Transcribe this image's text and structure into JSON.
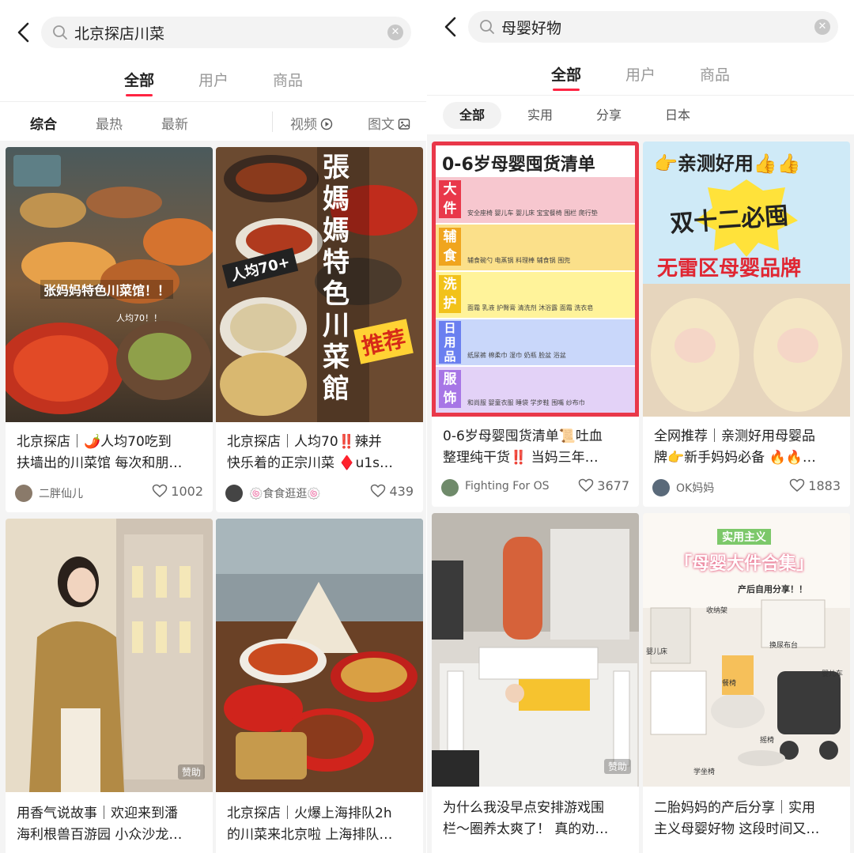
{
  "left": {
    "search_query": "北京探店川菜",
    "tabs": [
      {
        "label": "全部",
        "active": true
      },
      {
        "label": "用户",
        "active": false
      },
      {
        "label": "商品",
        "active": false
      }
    ],
    "filters": {
      "sort": [
        "综合",
        "最热",
        "最新"
      ],
      "video": "视频",
      "image_text": "图文"
    },
    "cards": [
      {
        "image_texts": [
          "张妈妈特色川菜馆！！",
          "人均70！！"
        ],
        "title_line1": "北京探店｜🌶️人均70吃到",
        "title_line2": "扶墙出的川菜馆 每次和朋…",
        "author": "二胖仙儿",
        "likes": "1002"
      },
      {
        "image_texts": [
          "張媽媽特色川菜館",
          "人均70+",
          "推荐"
        ],
        "title_line1": "北京探店｜人均70‼️辣并",
        "title_line2": "快乐着的正宗川菜 ♦️u1s…",
        "author": "🍥食食逛逛🍥",
        "likes": "439"
      },
      {
        "image_texts": [],
        "sponsor": "赞助",
        "title_line1": "用香气说故事｜欢迎来到潘",
        "title_line2": "海利根兽百游园 小众沙龙…"
      },
      {
        "image_texts": [],
        "title_line1": "北京探店｜火爆上海排队2h",
        "title_line2": "的川菜来北京啦 上海排队…"
      }
    ]
  },
  "right": {
    "search_query": "母婴好物",
    "tabs": [
      {
        "label": "全部",
        "active": true
      },
      {
        "label": "用户",
        "active": false
      },
      {
        "label": "商品",
        "active": false
      }
    ],
    "filters": [
      "全部",
      "实用",
      "分享",
      "日本"
    ],
    "cards": [
      {
        "image_texts": {
          "heading": "0-6岁母婴囤货清单",
          "rows": [
            {
              "label": "大件",
              "items": [
                "安全座椅",
                "婴儿车",
                "婴儿床",
                "宝宝餐椅",
                "围栏",
                "爬行垫"
              ]
            },
            {
              "label": "辅食",
              "items": [
                "辅食碗勺",
                "电蒸锅",
                "料理棒",
                "辅食锅",
                "围兜"
              ]
            },
            {
              "label": "洗护",
              "items": [
                "面霜",
                "乳液",
                "护臀膏",
                "清洗剂",
                "沐浴露",
                "面霜",
                "洗衣皂"
              ]
            },
            {
              "label": "日用品",
              "items": [
                "纸尿裤",
                "棉柔巾",
                "湿巾",
                "奶瓶",
                "脸盆",
                "浴盆"
              ]
            },
            {
              "label": "服饰",
              "items": [
                "和尚服",
                "婴童衣服",
                "睡袋",
                "学步鞋",
                "围嘴",
                "纱布巾"
              ]
            }
          ]
        },
        "title_line1": "0-6岁母婴囤货清单📜吐血",
        "title_line2": "整理纯干货‼️ 当妈三年…",
        "author": "Fighting For OS",
        "likes": "3677"
      },
      {
        "image_texts": [
          "👉亲测好用👍👍",
          "双十二必囤",
          "无雷区母婴品牌"
        ],
        "title_line1": "全网推荐｜亲测好用母婴品",
        "title_line2": "牌👉新手妈妈必备 🔥🔥…",
        "author": "OK妈妈",
        "likes": "1883"
      },
      {
        "image_texts": [],
        "sponsor": "赞助",
        "title_line1": "为什么我没早点安排游戏围",
        "title_line2": "栏～圈养太爽了！ 真的劝…"
      },
      {
        "image_texts": [
          "实用主义",
          "「母婴大件合集」",
          "产后自用分享！！",
          "收纳架",
          "婴儿床",
          "换尿布台",
          "餐椅",
          "摇椅",
          "婴儿车",
          "学坐椅"
        ],
        "title_line1": "二胎妈妈的产后分享｜实用",
        "title_line2": "主义母婴好物 这段时间又…"
      }
    ]
  }
}
